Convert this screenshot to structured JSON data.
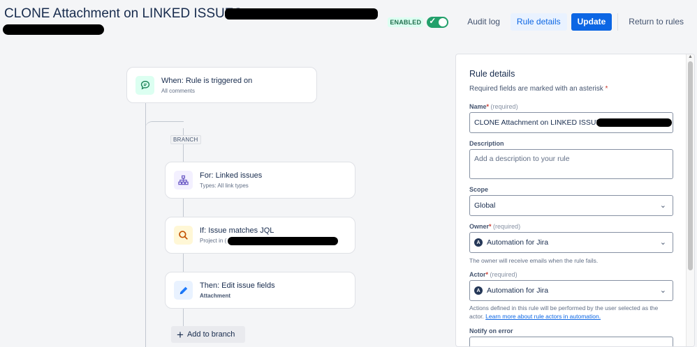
{
  "header": {
    "title": "CLONE Attachment on LINKED ISSUES",
    "enabled_label": "ENABLED",
    "audit_log": "Audit log",
    "rule_details": "Rule details",
    "update": "Update",
    "return_to_rules": "Return to rules"
  },
  "flow": {
    "trigger": {
      "title": "When: Rule is triggered on",
      "subtitle": "All comments"
    },
    "branch_tag": "BRANCH",
    "branch_step": {
      "title": "For: Linked issues",
      "subtitle": "Types: All link types"
    },
    "condition": {
      "title": "If: Issue matches JQL",
      "subtitle": "Project in ("
    },
    "action": {
      "title": "Then: Edit issue fields",
      "subtitle": "Attachment"
    },
    "add_branch": "Add to branch"
  },
  "panel": {
    "heading": "Rule details",
    "required_note": "Required fields are marked with an asterisk",
    "asterisk": "*",
    "name_label": "Name",
    "name_hint": "(required)",
    "name_value": "CLONE Attachment on LINKED ISSUES",
    "description_label": "Description",
    "description_placeholder": "Add a description to your rule",
    "scope_label": "Scope",
    "scope_value": "Global",
    "owner_label": "Owner",
    "owner_hint": "(required)",
    "owner_value": "Automation for Jira",
    "owner_helper": "The owner will receive emails when the rule fails.",
    "actor_label": "Actor",
    "actor_hint": "(required)",
    "actor_value": "Automation for Jira",
    "actor_helper": "Actions defined in this rule will be performed by the user selected as the actor.",
    "actor_link": "Learn more about rule actors in automation.",
    "notify_label": "Notify on error",
    "avatar_letter": "A"
  },
  "colors": {
    "primary": "#0c66e4",
    "enabled_green": "#22a06b",
    "trigger_icon_bg": "#dcfff1",
    "branch_icon_bg": "#f3f0ff",
    "condition_icon_bg": "#fff7d6",
    "action_icon_bg": "#e9f2ff"
  },
  "icons": {
    "trigger": "comment-icon",
    "branch": "hierarchy-icon",
    "condition": "search-icon",
    "action": "pencil-icon",
    "add": "plus-icon",
    "dropdown": "chevron-down-icon",
    "toggle_check": "check-icon"
  }
}
